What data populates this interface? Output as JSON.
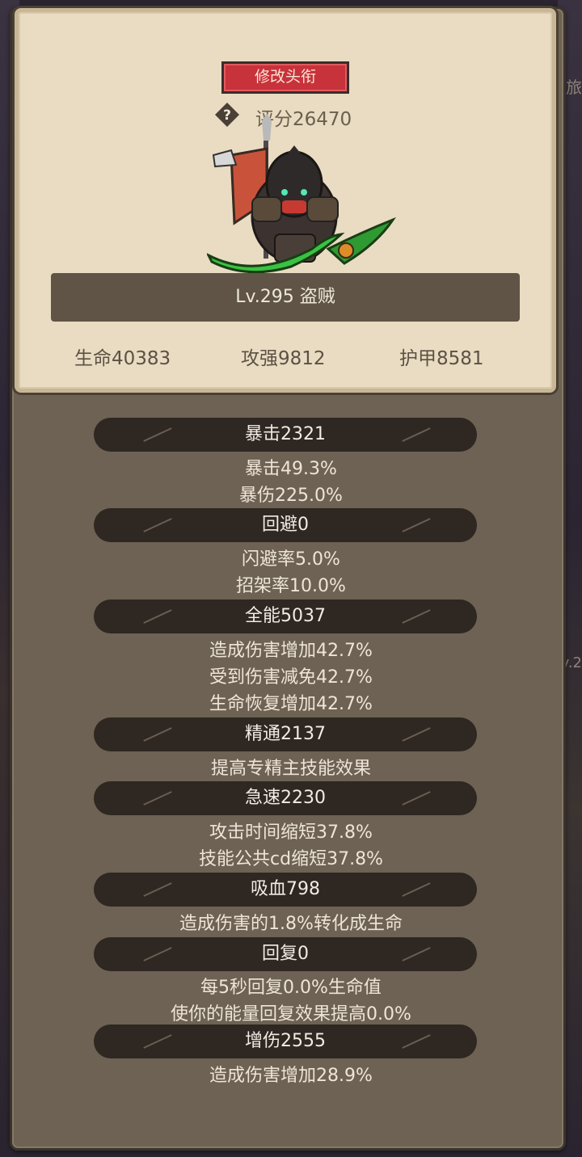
{
  "header": {
    "title_button": "修改头衔",
    "score": "评分26470"
  },
  "hero": {
    "level_class": "Lv.295 盗贼",
    "life": "生命40383",
    "attack": "攻强9812",
    "armor": "护甲8581"
  },
  "background": {
    "right_text": "旅",
    "right_lv": "v.2"
  },
  "stats": [
    {
      "title": "暴击2321",
      "lines": [
        "暴击49.3%",
        "暴伤225.0%"
      ]
    },
    {
      "title": "回避0",
      "lines": [
        "闪避率5.0%",
        "招架率10.0%"
      ]
    },
    {
      "title": "全能5037",
      "lines": [
        "造成伤害增加42.7%",
        "受到伤害减免42.7%",
        "生命恢复增加42.7%"
      ]
    },
    {
      "title": "精通2137",
      "lines": [
        "提高专精主技能效果"
      ]
    },
    {
      "title": "急速2230",
      "lines": [
        "攻击时间缩短37.8%",
        "技能公共cd缩短37.8%"
      ]
    },
    {
      "title": "吸血798",
      "lines": [
        "造成伤害的1.8%转化成生命"
      ]
    },
    {
      "title": "回复0",
      "lines": [
        "每5秒回复0.0%生命值",
        "使你的能量回复效果提高0.0%"
      ]
    },
    {
      "title": "增伤2555",
      "lines": [
        "造成伤害增加28.9%"
      ]
    }
  ],
  "colors": {
    "card": "#e9dcc2",
    "panel": "#6d6253",
    "bar": "#2e2722",
    "title_button": "#c8323b"
  }
}
